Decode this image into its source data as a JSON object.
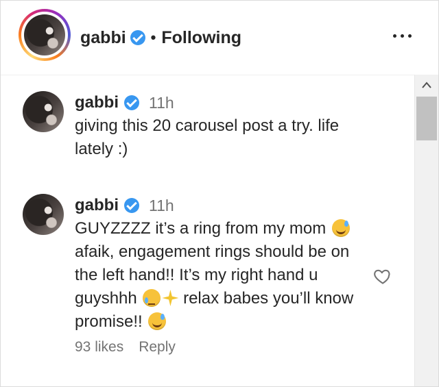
{
  "header": {
    "username": "gabbi",
    "separator": "•",
    "follow_status": "Following",
    "more_icon": "more-horizontal-icon"
  },
  "comments": [
    {
      "username": "gabbi",
      "time": "11h",
      "text": "giving this 20 carousel post a try. life lately :)"
    },
    {
      "username": "gabbi",
      "time": "11h",
      "text_parts": [
        "GUYZZZZ it’s a ring from my mom",
        "afaik, engagement rings should be on the left hand!! It’s my right hand u guyshhh",
        "relax babes you’ll know promise!!"
      ],
      "likes": "93 likes",
      "reply_label": "Reply",
      "like_icon": "heart-outline-icon"
    }
  ],
  "colors": {
    "verified": "#3897f0",
    "muted_text": "#737373",
    "primary_text": "#262626"
  }
}
